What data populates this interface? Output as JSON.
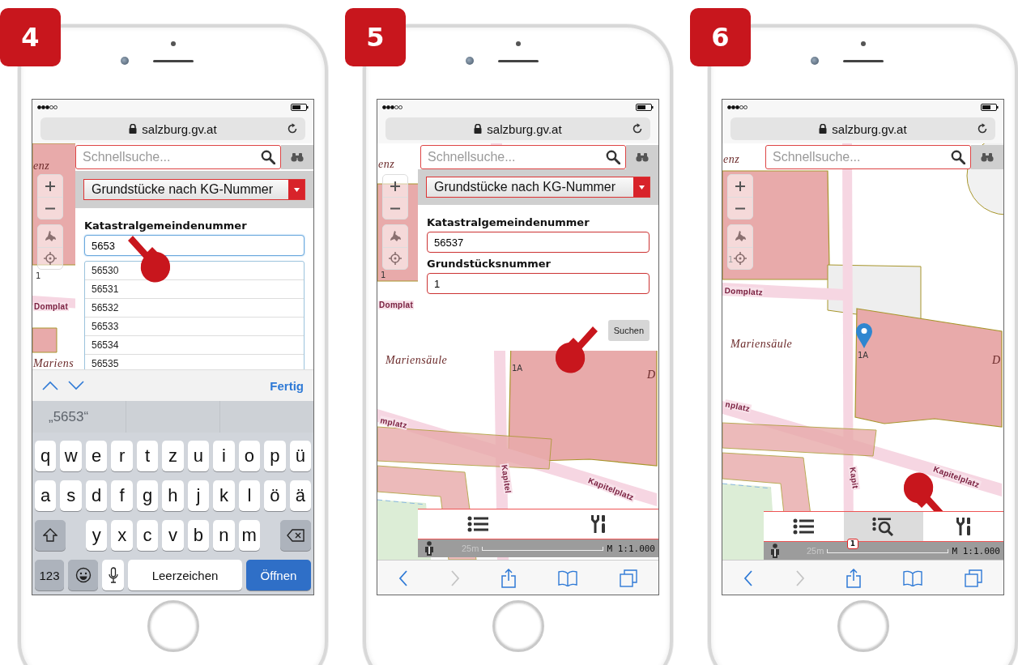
{
  "steps": [
    {
      "number": "4",
      "url": "salzburg.gv.at",
      "search": {
        "placeholder": "Schnellsuche..."
      },
      "map_labels": [
        "enz",
        "1",
        "Domplat",
        "Mariens"
      ],
      "panel": {
        "dropdown": "Grundstücke nach KG-Nummer",
        "fields": [
          {
            "label": "Katastralgemeindenummer",
            "value": "5653",
            "focused": true
          }
        ],
        "suggestions": [
          "56530",
          "56531",
          "56532",
          "56533",
          "56534",
          "56535"
        ]
      },
      "keyboard": {
        "done": "Fertig",
        "prediction": "„5653“",
        "rows": [
          [
            "q",
            "w",
            "e",
            "r",
            "t",
            "z",
            "u",
            "i",
            "o",
            "p",
            "ü"
          ],
          [
            "a",
            "s",
            "d",
            "f",
            "g",
            "h",
            "j",
            "k",
            "l",
            "ö",
            "ä"
          ]
        ],
        "shift_row": [
          "y",
          "x",
          "c",
          "v",
          "b",
          "n",
          "m"
        ],
        "numbers_key": "123",
        "space_key": "Leerzeichen",
        "return_key": "Öffnen"
      }
    },
    {
      "number": "5",
      "url": "salzburg.gv.at",
      "search": {
        "placeholder": "Schnellsuche..."
      },
      "map_labels": [
        "enz",
        "1",
        "Domplat",
        "Mariensäule",
        "1A",
        "D",
        "mplatz",
        "Kapitelplatz",
        "Kapitel"
      ],
      "panel": {
        "dropdown": "Grundstücke nach KG-Nummer",
        "fields": [
          {
            "label": "Katastralgemeindenummer",
            "value": "56537",
            "focused": false
          },
          {
            "label": "Grundstücksnummer",
            "value": "1",
            "focused": false
          }
        ],
        "button": "Suchen"
      },
      "toolbar": {
        "tools": [
          {
            "kind": "list",
            "selected": false
          },
          {
            "kind": "tools",
            "selected": false
          }
        ]
      },
      "scale": {
        "distance": "25m",
        "ratio": "M 1:1.000"
      }
    },
    {
      "number": "6",
      "url": "salzburg.gv.at",
      "search": {
        "placeholder": "Schnellsuche..."
      },
      "map_labels": [
        "enz",
        "1",
        "Domplatz",
        "Mariensäule",
        "1A",
        "D",
        "nplatz",
        "Kapitelplatz",
        "Kapit"
      ],
      "toolbar": {
        "tools": [
          {
            "kind": "list",
            "selected": false
          },
          {
            "kind": "search-results",
            "selected": true,
            "badge": "1"
          },
          {
            "kind": "tools",
            "selected": false
          }
        ]
      },
      "scale": {
        "distance": "25m",
        "ratio": "M 1:1.000"
      }
    }
  ]
}
